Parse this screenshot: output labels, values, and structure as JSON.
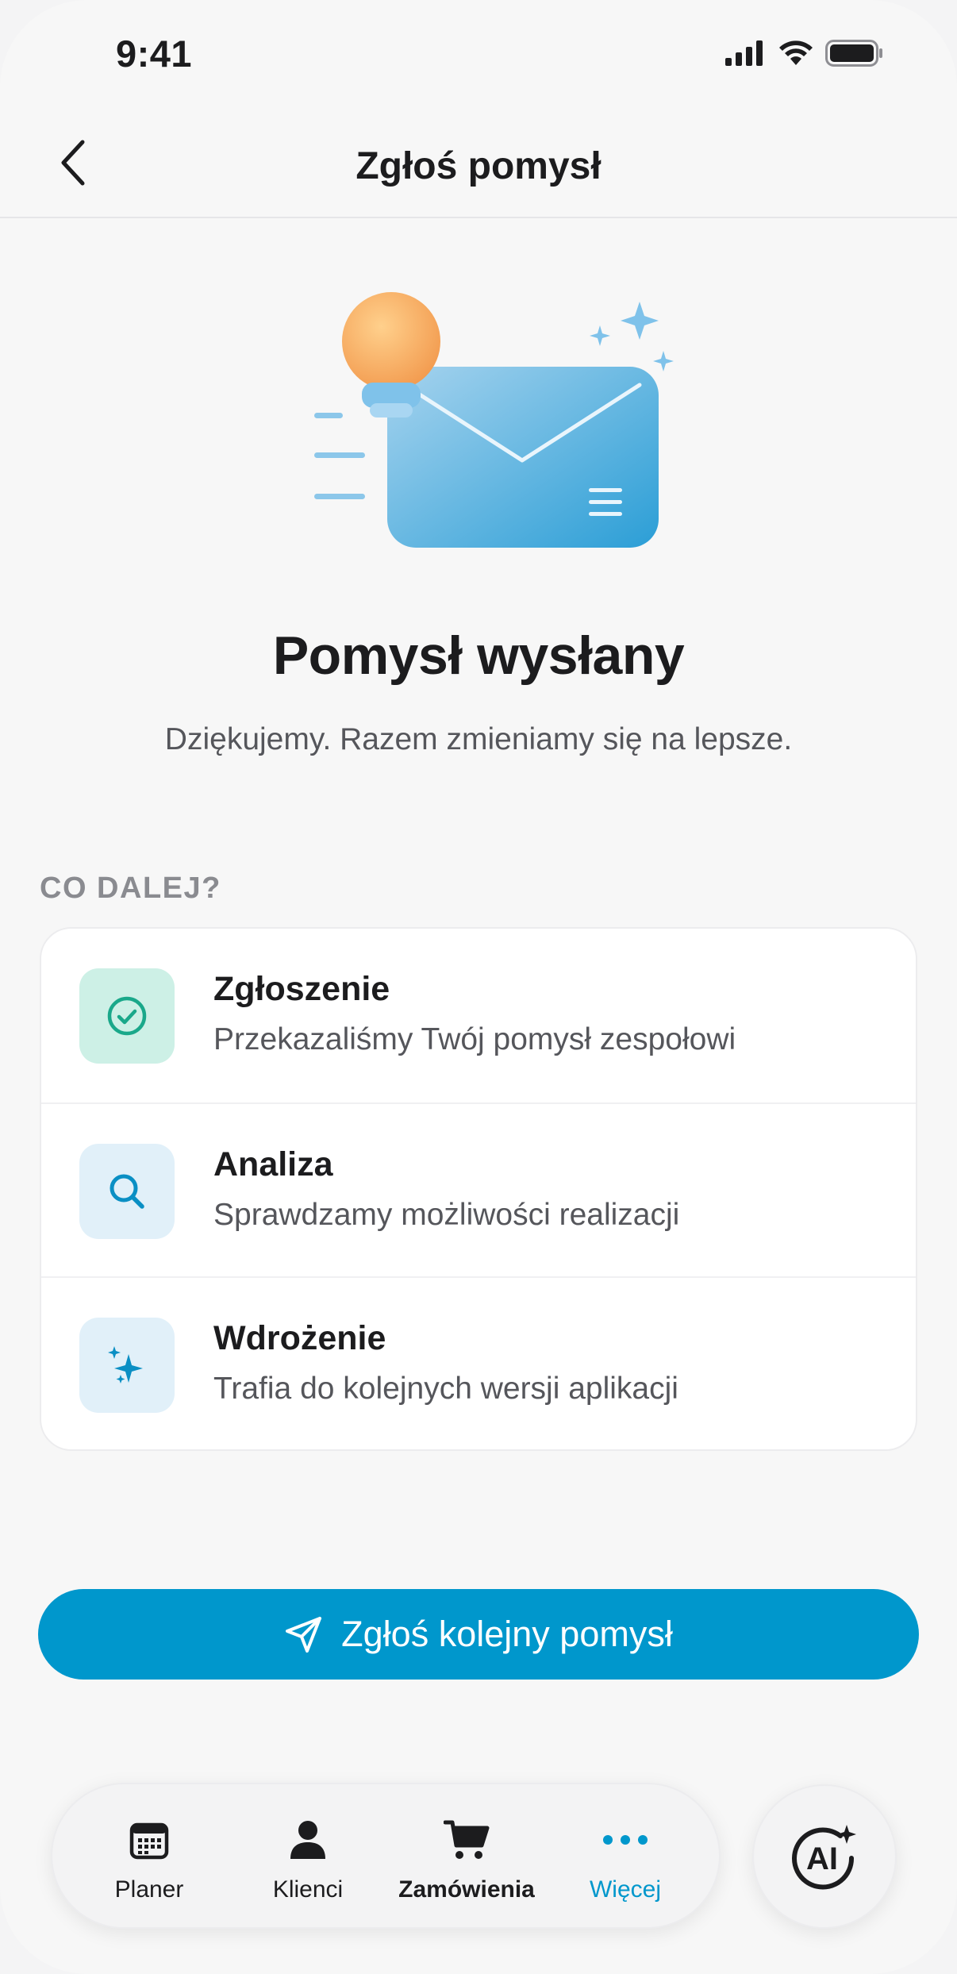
{
  "status_bar": {
    "time": "9:41"
  },
  "header": {
    "title": "Zgłoś pomysł"
  },
  "hero": {
    "illustration": "lightbulb-envelope-illustration"
  },
  "confirmation": {
    "title": "Pomysł wysłany",
    "subtitle": "Dziękujemy. Razem zmieniamy się na lepsze."
  },
  "next_steps": {
    "label": "CO DALEJ?",
    "items": [
      {
        "title": "Zgłoszenie",
        "description": "Przekazaliśmy Twój pomysł zespołowi",
        "icon": "check-circle-icon",
        "color": "#1aa88a",
        "bg": "#cdf0e6"
      },
      {
        "title": "Analiza",
        "description": "Sprawdzamy możliwości realizacji",
        "icon": "search-icon",
        "color": "#0a8fc4",
        "bg": "#e1f0f9"
      },
      {
        "title": "Wdrożenie",
        "description": "Trafia do kolejnych wersji aplikacji",
        "icon": "sparkles-icon",
        "color": "#0a8fc4",
        "bg": "#e1f0f9"
      }
    ]
  },
  "cta": {
    "label": "Zgłoś kolejny pomysł",
    "icon": "send-icon",
    "color": "#0097cc"
  },
  "tab_bar": {
    "tabs": [
      {
        "label": "Planer",
        "icon": "calendar-icon"
      },
      {
        "label": "Klienci",
        "icon": "person-icon"
      },
      {
        "label": "Zamówienia",
        "icon": "cart-icon"
      },
      {
        "label": "Więcej",
        "icon": "more-dots-icon",
        "active": true
      }
    ],
    "ai_button": {
      "label": "AI",
      "icon": "ai-sparkle-icon"
    }
  }
}
